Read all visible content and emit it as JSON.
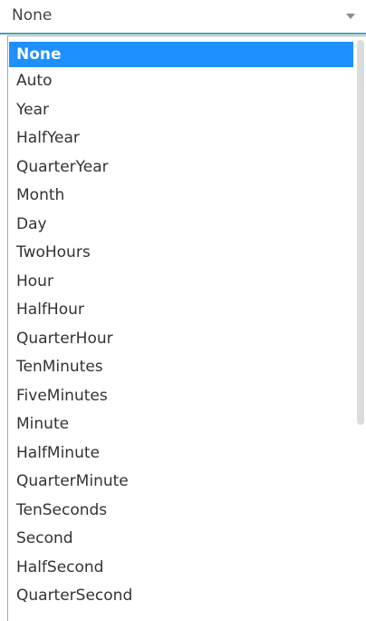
{
  "select": {
    "value": "None",
    "arrow_icon": "caret-down-icon"
  },
  "dropdown": {
    "selected_index": 0,
    "items": [
      {
        "label": "None"
      },
      {
        "label": "Auto"
      },
      {
        "label": "Year"
      },
      {
        "label": "HalfYear"
      },
      {
        "label": "QuarterYear"
      },
      {
        "label": "Month"
      },
      {
        "label": "Day"
      },
      {
        "label": "TwoHours"
      },
      {
        "label": "Hour"
      },
      {
        "label": "HalfHour"
      },
      {
        "label": "QuarterHour"
      },
      {
        "label": "TenMinutes"
      },
      {
        "label": "FiveMinutes"
      },
      {
        "label": "Minute"
      },
      {
        "label": "HalfMinute"
      },
      {
        "label": "QuarterMinute"
      },
      {
        "label": "TenSeconds"
      },
      {
        "label": "Second"
      },
      {
        "label": "HalfSecond"
      },
      {
        "label": "QuarterSecond"
      }
    ]
  },
  "colors": {
    "selected_bg": "#1e90ff",
    "focus_underline": "#4aa0a7"
  }
}
